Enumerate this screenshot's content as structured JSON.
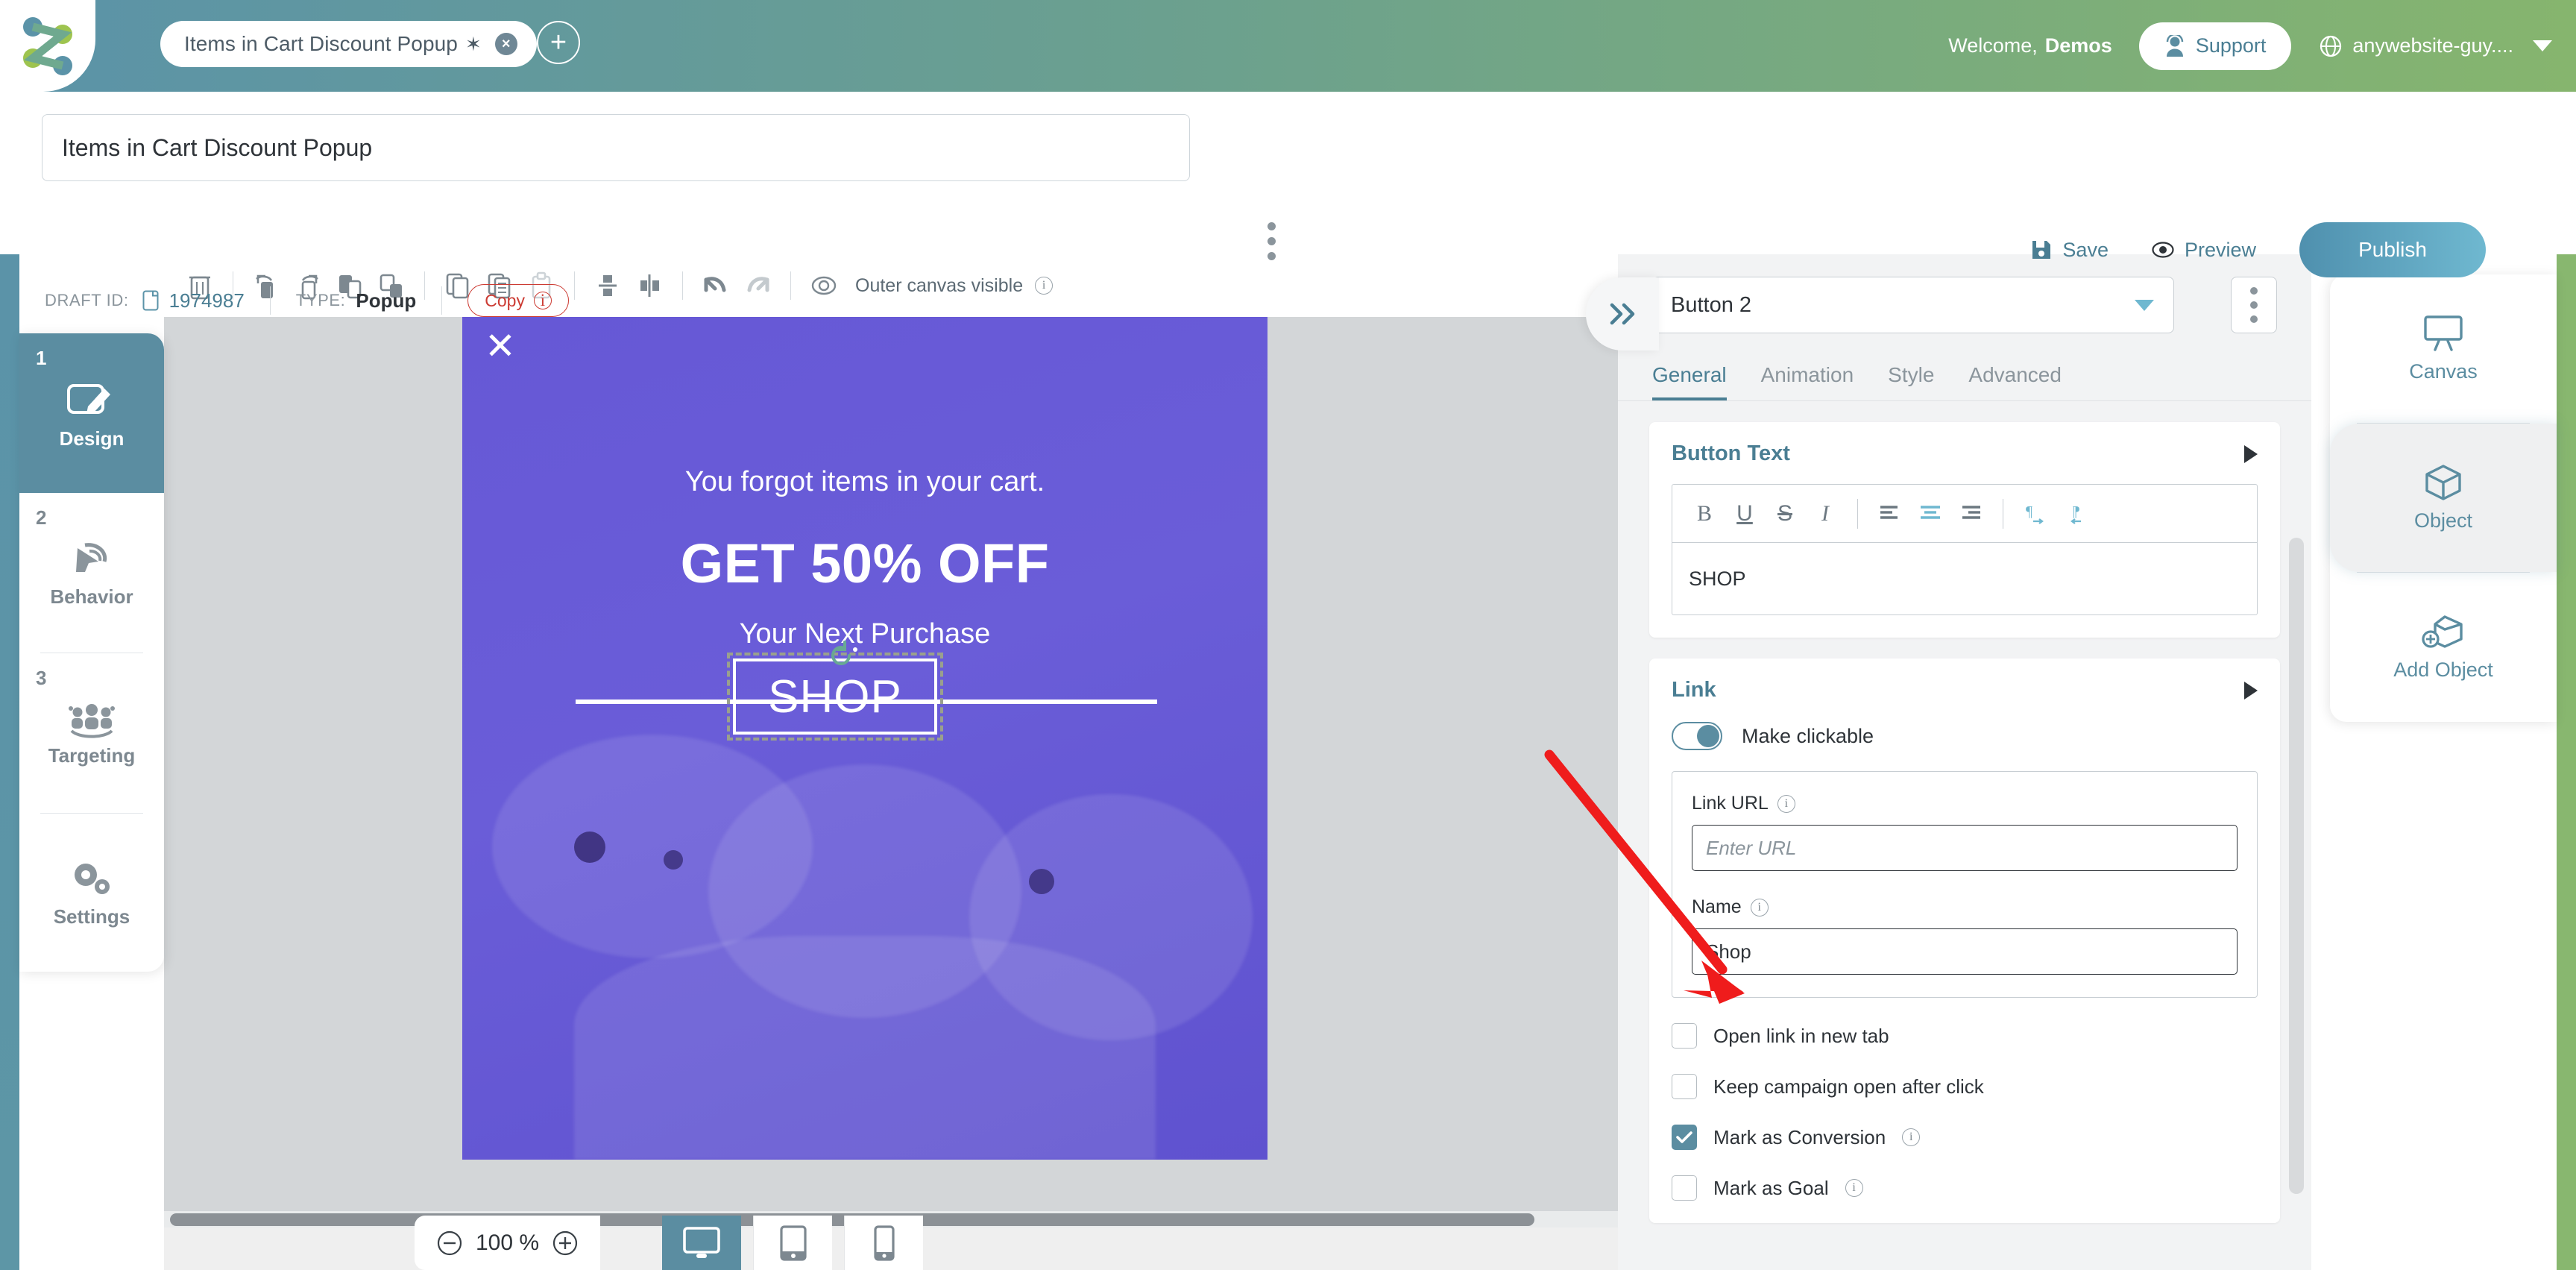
{
  "header": {
    "tab_title": "Items in Cart Discount Popup",
    "tab_modified_marker": "✶",
    "welcome_prefix": "Welcome,",
    "welcome_user": "Demos",
    "support_label": "Support",
    "site_name": "anywebsite-guy....",
    "brand_gradient": [
      "#5b93a8",
      "#6ba08f",
      "#86b56e"
    ]
  },
  "campaign": {
    "name": "Items in Cart Discount Popup",
    "draft_id_label": "DRAFT ID:",
    "draft_id": "1974987",
    "type_label": "TYPE:",
    "type_value": "Popup",
    "copy_label": "Copy",
    "save_label": "Save",
    "preview_label": "Preview",
    "publish_label": "Publish"
  },
  "steps": [
    {
      "num": "1",
      "label": "Design",
      "icon": "design-pencil-icon",
      "active": true
    },
    {
      "num": "2",
      "label": "Behavior",
      "icon": "behavior-cursor-target-icon",
      "active": false
    },
    {
      "num": "3",
      "label": "Targeting",
      "icon": "targeting-people-icon",
      "active": false
    },
    {
      "num": "",
      "label": "Settings",
      "icon": "settings-gears-icon",
      "active": false
    }
  ],
  "canvas_toolbar": {
    "outer_canvas_label": "Outer canvas visible",
    "icons": [
      "trash-icon",
      "rotate-right-icon",
      "rotate-left-icon",
      "bring-forward-icon",
      "send-backward-icon",
      "duplicate-icon",
      "copy-icon",
      "paste-icon",
      "align-vertical-center-icon",
      "align-horizontal-center-icon",
      "undo-icon",
      "redo-icon",
      "outer-canvas-eye-icon"
    ]
  },
  "popup_preview": {
    "close_glyph": "✕",
    "subheadline_top": "You forgot items in your cart.",
    "headline": "GET 50% OFF",
    "subheadline_bottom": "Your Next Purchase",
    "button_text": "SHOP",
    "background_color": "#6658d6"
  },
  "viewport_bar": {
    "zoom_out_icon": "minus-circle-icon",
    "zoom_level": "100 %",
    "zoom_in_icon": "plus-circle-icon",
    "devices": [
      {
        "name": "desktop",
        "icon": "monitor-icon",
        "active": true
      },
      {
        "name": "tablet",
        "icon": "tablet-icon",
        "active": false
      },
      {
        "name": "mobile",
        "icon": "phone-icon",
        "active": false
      }
    ]
  },
  "properties_panel": {
    "object_selected": "Button 2",
    "kebab_icon": "more-vertical-icon",
    "tabs": [
      {
        "label": "General",
        "active": true
      },
      {
        "label": "Animation",
        "active": false
      },
      {
        "label": "Style",
        "active": false
      },
      {
        "label": "Advanced",
        "active": false
      }
    ],
    "button_text_section": {
      "title": "Button Text",
      "expand_icon": "triangle-right-icon",
      "tools": [
        {
          "name": "bold-icon",
          "glyph": "B",
          "active": false
        },
        {
          "name": "underline-icon",
          "glyph": "U",
          "active": false
        },
        {
          "name": "strikethrough-icon",
          "glyph": "S",
          "active": false
        },
        {
          "name": "italic-icon",
          "glyph": "I",
          "active": false
        },
        {
          "name": "align-left-icon",
          "glyph": "",
          "active": false
        },
        {
          "name": "align-center-icon",
          "glyph": "",
          "active": true
        },
        {
          "name": "align-right-icon",
          "glyph": "",
          "active": false
        },
        {
          "name": "ltr-direction-icon",
          "glyph": "",
          "active": true
        },
        {
          "name": "rtl-direction-icon",
          "glyph": "",
          "active": true
        }
      ],
      "value": "SHOP"
    },
    "link_section": {
      "title": "Link",
      "expand_icon": "triangle-right-icon",
      "make_clickable_label": "Make clickable",
      "make_clickable_on": true,
      "link_url_label": "Link URL",
      "link_url_value": "",
      "link_url_placeholder": "Enter URL",
      "name_label": "Name",
      "name_value": "Shop",
      "checkboxes": [
        {
          "label": "Open link in new tab",
          "checked": false,
          "has_info": false
        },
        {
          "label": "Keep campaign open after click",
          "checked": false,
          "has_info": false
        },
        {
          "label": "Mark as Conversion",
          "checked": true,
          "has_info": true
        },
        {
          "label": "Mark as Goal",
          "checked": false,
          "has_info": true
        }
      ]
    }
  },
  "right_rail": [
    {
      "label": "Canvas",
      "icon": "canvas-board-icon",
      "active": false
    },
    {
      "label": "Object",
      "icon": "cube-icon",
      "active": true
    },
    {
      "label": "Add Object",
      "icon": "add-cube-icon",
      "active": false
    }
  ],
  "annotation": {
    "arrow_color": "#ef1c1c",
    "points_to": "Name"
  }
}
